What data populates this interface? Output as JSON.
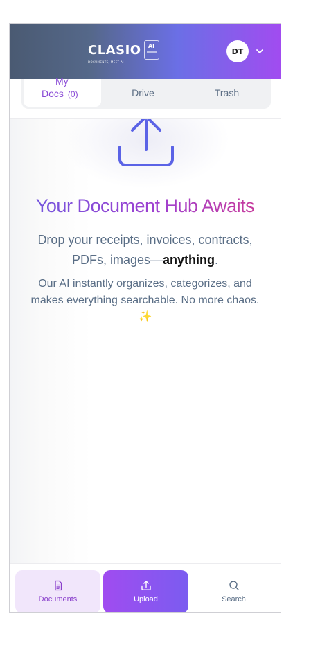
{
  "header": {
    "logo_word": "CLASIO",
    "logo_tagline": "DOCUMENTS, MEET AI",
    "logo_badge": "AI",
    "avatar_initials": "DT"
  },
  "tabs": [
    {
      "label_line1": "My",
      "label_line2": "Docs",
      "count": "(0)",
      "active": true
    },
    {
      "label": "Drive",
      "active": false
    },
    {
      "label": "Trash",
      "active": false
    }
  ],
  "empty_state": {
    "headline": "Your Document Hub Awaits",
    "line1_text": "Drop your receipts, invoices, contracts, PDFs, images—",
    "line1_bold": "anything",
    "line1_end": ".",
    "line2": "Our AI instantly organizes, categorizes, and makes everything searchable. No more chaos. ✨"
  },
  "bottom_nav": {
    "documents_label": "Documents",
    "upload_label": "Upload",
    "search_label": "Search"
  },
  "colors": {
    "accent_purple": "#a04cf0",
    "headline_start": "#6b59e0",
    "headline_end": "#d0388f",
    "muted_text": "#5a6e86"
  },
  "icons": [
    "chevron-down-icon",
    "upload-icon",
    "document-icon",
    "search-icon"
  ]
}
